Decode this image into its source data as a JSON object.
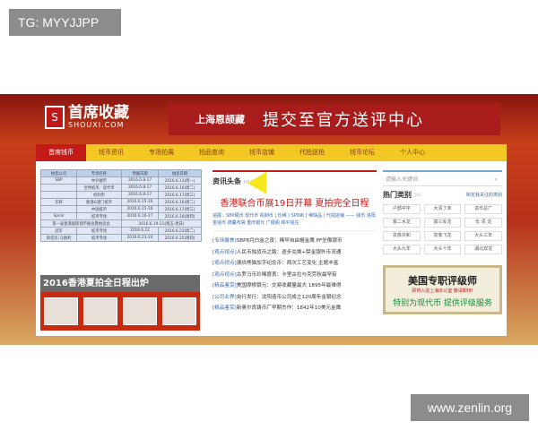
{
  "overlay": {
    "tag": "TG: MYYJJPP",
    "watermark": "www.zenlin.org"
  },
  "header": {
    "logo_mark": "S",
    "logo_cn": "首席收藏",
    "logo_en": "SHOUXI.COM",
    "ad_brand": "上海恩颉藏",
    "ad_text": "提交至官方送评中心"
  },
  "nav": [
    "首席钱币",
    "钱币资讯",
    "专场拍展",
    "拍品查询",
    "钱币店铺",
    "代拍送拍",
    "钱币论坛",
    "个人中心"
  ],
  "schedule": {
    "headers": [
      "拍卖公司",
      "专场名称",
      "预展日期",
      "拍卖日期"
    ],
    "rows": [
      [
        "SBP",
        "中外硬币",
        "2016.6.8-17",
        "2016.6.13(周一)"
      ],
      [
        "",
        "世界纸币、现代币",
        "2016.6.8-17",
        "2016.6.16(周二)"
      ],
      [
        "",
        "机制币",
        "2016.6.8-17",
        "2016.6.17(周三)"
      ],
      [
        "华辉",
        "香港&澳门纸币",
        "2016.6.15-16",
        "2016.6.16(周二)"
      ],
      [
        "",
        "中国纸币",
        "2016.6.15-16",
        "2016.6.17(周三)"
      ],
      [
        "Spink",
        "纸币专场",
        "2016.6.16-17",
        "2016.6.18(周四)"
      ],
      [
        "第一届香港国际钱币展会暨拍卖会",
        "",
        "2016.6.19-21(周五-周日)",
        ""
      ],
      [
        "冠军",
        "纸币专场",
        "2016.6.22",
        "2016.6.23(周二)"
      ],
      [
        "斯塔克-马驰利",
        "纸币专场",
        "2016.6.23-24",
        "2016.6.25(周四)"
      ]
    ],
    "banner": "2016香港夏拍全日程出炉"
  },
  "news": {
    "heading": "资讯头条",
    "heading_en": "HEADLINE",
    "headline": "香港联合币展19日开幕 夏拍完全日程",
    "links": "拍展：SBP硬币 现代币 机制币 | 珍稀 | SPINK | 稀缺品 | 代拍店铺 —— 钱币 洛阳金钱币 德馨布袋 重庆银元 广银阁 和平钱庄",
    "items": [
      [
        "[专场聚焦]",
        "SBP8月白金之夜：稀罕自由帽金鹰 PF坐像银币"
      ],
      [
        "[观点视点]",
        "人民币独货币之路：逐步兑换+禁金银外币流通"
      ],
      [
        "[观点视点]",
        "澳玖熊猫加字纪念币：两次工艺变化 主题丰富"
      ],
      [
        "[观点视点]",
        "古罗马币珍稀度表：卡里古拉与克劳狄最罕有"
      ],
      [
        "[精品鉴赏]",
        "美国摩根银元：交易收藏量最大 1895年最难得"
      ],
      [
        "[公司业界]",
        "央行发行：沈阳造币公司成立120周年金银纪念"
      ],
      [
        "[精品鉴赏]",
        "新奥尔良铸币厂早期杰作：1842年10美元金鹰"
      ]
    ]
  },
  "sidebar": {
    "search_placeholder": "请输入关键词",
    "hot_title": "热门类别",
    "hot_tag": "TAG",
    "hot_link": "制定我关注的类别",
    "tags": [
      "户部中字",
      "大清丁未",
      "造币总厂",
      "富二水龙",
      "富三反龙",
      "长 须 龙",
      "袁像共和",
      "袁像飞龙",
      "大头三年",
      "大头九年",
      "大头十年",
      "湖北双龙"
    ],
    "promo": {
      "title": "美国专职评级师",
      "sub": "即将入驻上海办公室 敬请期待!",
      "line": "特别为现代币 提供评级服务"
    }
  }
}
